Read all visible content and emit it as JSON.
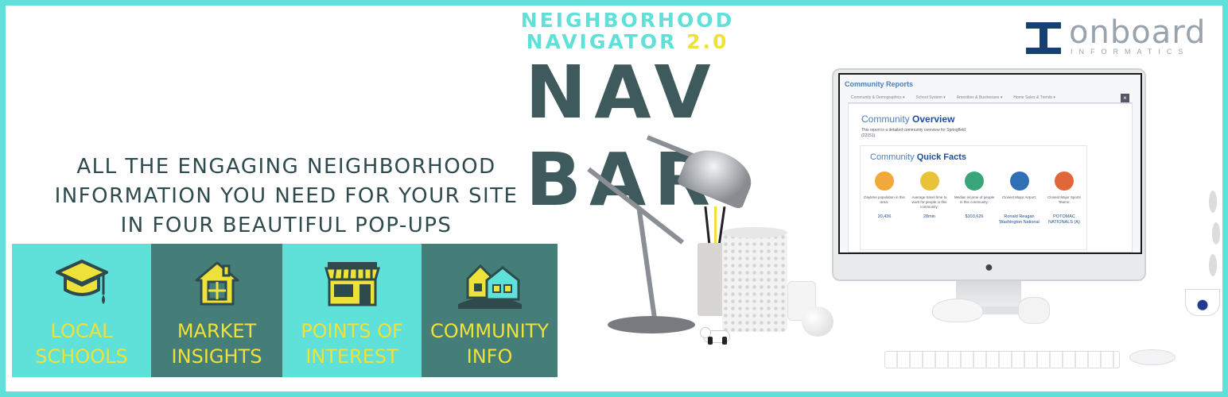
{
  "header": {
    "kicker_line1": "NEIGHBORHOOD",
    "kicker_line2_text": "NAVIGATOR",
    "kicker_version": "2.0",
    "title": "NAV BAR"
  },
  "logo": {
    "wordmark": "onboard",
    "subtext": "INFORMATICS",
    "color": "#163f72"
  },
  "tagline": {
    "line1": "ALL THE ENGAGING NEIGHBORHOOD",
    "line2": "INFORMATION YOU NEED FOR YOUR SITE",
    "line3": "IN FOUR BEAUTIFUL POP-UPS"
  },
  "tiles": [
    {
      "line1": "LOCAL",
      "line2": "SCHOOLS",
      "icon": "graduation-cap-icon"
    },
    {
      "line1": "MARKET",
      "line2": "INSIGHTS",
      "icon": "house-icon"
    },
    {
      "line1": "POINTS OF",
      "line2": "INTEREST",
      "icon": "storefront-icon"
    },
    {
      "line1": "COMMUNITY",
      "line2": "INFO",
      "icon": "neighborhood-icon"
    }
  ],
  "screen": {
    "report_title": "Community Reports",
    "tabs": [
      "Community & Demographics ▾",
      "School System ▾",
      "Amenities & Businesses ▾",
      "Home Sales & Trends ▾"
    ],
    "close_label": "×",
    "overview_prefix": "Community",
    "overview_strong": "Overview",
    "overview_desc": "This report is a detailed community overview for Springfield (22151).",
    "quick_prefix": "Community",
    "quick_strong": "Quick Facts",
    "facts": [
      {
        "label": "Daytime population in this area:",
        "value": "20,436",
        "color": "#f2a93b"
      },
      {
        "label": "Average travel time to work for people in this community:",
        "value": "28min",
        "color": "#e8c33a"
      },
      {
        "label": "Median income of people in this community:",
        "value": "$103,626",
        "color": "#3aa57a"
      },
      {
        "label": "Closest Major Airport:",
        "value": "Ronald Reagan Washington National",
        "color": "#2f6fb3"
      },
      {
        "label": "Closest Major Sports Teams:",
        "value": "POTOMAC NATIONALS (A)",
        "color": "#e0673a"
      }
    ]
  },
  "colors": {
    "teal": "#5fe0d8",
    "dark_teal": "#457d78",
    "yellow": "#eee23a",
    "title_slate": "#3e5a5c"
  }
}
